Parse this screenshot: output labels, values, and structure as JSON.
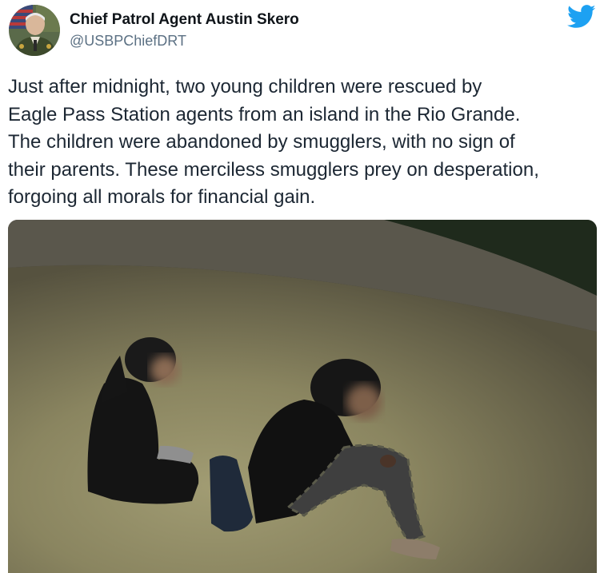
{
  "author": {
    "display_name": "Chief Patrol Agent Austin Skero",
    "handle": "@USBPChiefDRT",
    "avatar_icon": "profile-photo"
  },
  "platform": {
    "logo_icon": "twitter-bird-icon",
    "brand_color": "#1da1f2"
  },
  "tweet": {
    "text": "Just after midnight, two young children were rescued by\nEagle Pass Station agents from an island in the Rio Grande.\nThe children were abandoned by smugglers, with no sign of\ntheir parents. These merciless smugglers prey on desperation,\nforgoing all morals for financial gain."
  },
  "media": {
    "type": "photo",
    "subject_icon": "night-photo-two-children-seated-on-grass"
  },
  "colors": {
    "name_text": "#0f1419",
    "handle_text": "#5b7083",
    "body_text": "#1c2733"
  }
}
